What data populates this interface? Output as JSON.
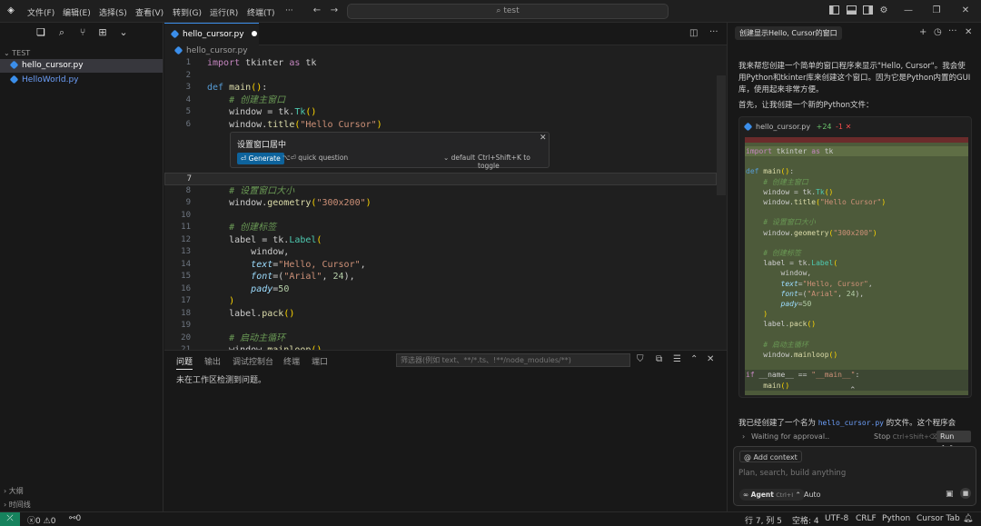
{
  "titlebar": {
    "menus": [
      "文件(F)",
      "编辑(E)",
      "选择(S)",
      "查看(V)",
      "转到(G)",
      "运行(R)",
      "终端(T)",
      "···"
    ],
    "search": "test"
  },
  "explorer": {
    "root": "TEST",
    "files": [
      "hello_cursor.py",
      "HelloWorld.py"
    ],
    "outline_label": "大纲",
    "timeline_label": "时间线"
  },
  "editor": {
    "tab_label": "hello_cursor.py",
    "breadcrumb": "hello_cursor.py",
    "lines": [
      {
        "n": "1",
        "tokens": [
          [
            "kw",
            "import"
          ],
          [
            "",
            " tkinter "
          ],
          [
            "kw",
            "as"
          ],
          [
            "",
            " tk"
          ]
        ]
      },
      {
        "n": "2",
        "tokens": []
      },
      {
        "n": "3",
        "tokens": [
          [
            "kwb",
            "def"
          ],
          [
            "",
            " "
          ],
          [
            "fn",
            "main"
          ],
          [
            "yel",
            "()"
          ],
          [
            "",
            ":"
          ]
        ]
      },
      {
        "n": "4",
        "tokens": [
          [
            "",
            "    "
          ],
          [
            "cm",
            "# 创建主窗口"
          ]
        ]
      },
      {
        "n": "5",
        "tokens": [
          [
            "",
            "    window = tk."
          ],
          [
            "cls",
            "Tk"
          ],
          [
            "yel",
            "()"
          ]
        ]
      },
      {
        "n": "6",
        "tokens": [
          [
            "",
            "    window."
          ],
          [
            "fn",
            "title"
          ],
          [
            "yel",
            "("
          ],
          [
            "str",
            "\"Hello Cursor\""
          ],
          [
            "yel",
            ")"
          ]
        ]
      },
      {
        "n": "7",
        "tokens": []
      },
      {
        "n": "8",
        "tokens": [
          [
            "",
            "    "
          ],
          [
            "cm",
            "# 设置窗口大小"
          ]
        ]
      },
      {
        "n": "9",
        "tokens": [
          [
            "",
            "    window."
          ],
          [
            "fn",
            "geometry"
          ],
          [
            "yel",
            "("
          ],
          [
            "str",
            "\"300x200\""
          ],
          [
            "yel",
            ")"
          ]
        ]
      },
      {
        "n": "10",
        "tokens": []
      },
      {
        "n": "11",
        "tokens": [
          [
            "",
            "    "
          ],
          [
            "cm",
            "# 创建标签"
          ]
        ]
      },
      {
        "n": "12",
        "tokens": [
          [
            "",
            "    label = tk."
          ],
          [
            "cls",
            "Label"
          ],
          [
            "yel",
            "("
          ]
        ]
      },
      {
        "n": "13",
        "tokens": [
          [
            "",
            "        window,"
          ]
        ]
      },
      {
        "n": "14",
        "tokens": [
          [
            "",
            "        "
          ],
          [
            "prm",
            "text"
          ],
          [
            "",
            "="
          ],
          [
            "str",
            "\"Hello, Cursor\""
          ],
          [
            "",
            ","
          ]
        ]
      },
      {
        "n": "15",
        "tokens": [
          [
            "",
            "        "
          ],
          [
            "prm",
            "font"
          ],
          [
            "",
            "=("
          ],
          [
            "str",
            "\"Arial\""
          ],
          [
            "",
            ", "
          ],
          [
            "num",
            "24"
          ],
          [
            "",
            "),"
          ]
        ]
      },
      {
        "n": "16",
        "tokens": [
          [
            "",
            "        "
          ],
          [
            "prm",
            "pady"
          ],
          [
            "",
            "="
          ],
          [
            "num",
            "50"
          ]
        ]
      },
      {
        "n": "17",
        "tokens": [
          [
            "",
            "    "
          ],
          [
            "yel",
            ")"
          ]
        ]
      },
      {
        "n": "18",
        "tokens": [
          [
            "",
            "    label."
          ],
          [
            "fn",
            "pack"
          ],
          [
            "yel",
            "()"
          ]
        ]
      },
      {
        "n": "19",
        "tokens": []
      },
      {
        "n": "20",
        "tokens": [
          [
            "",
            "    "
          ],
          [
            "cm",
            "# 启动主循环"
          ]
        ]
      },
      {
        "n": "21",
        "tokens": [
          [
            "",
            "    window."
          ],
          [
            "fn",
            "mainloop"
          ],
          [
            "yel",
            "()"
          ]
        ]
      }
    ],
    "inline_prompt": {
      "title": "设置窗口居中",
      "generate": "Generate",
      "quick": "quick question",
      "model": "default",
      "hint": "Ctrl+Shift+K to toggle"
    }
  },
  "panel": {
    "tabs": [
      "问题",
      "输出",
      "调试控制台",
      "终端",
      "端口"
    ],
    "filter_placeholder": "筛选器(例如 text、**/*.ts、!**/node_modules/**)",
    "message": "未在工作区检测到问题。"
  },
  "chat": {
    "title": "创建显示Hello, Cursor的窗口",
    "intro": "我来帮您创建一个简单的窗口程序来显示\"Hello, Cursor\"。我会使用Python和tkinter库来创建这个窗口。因为它是Python内置的GUI库，使用起来非常方便。",
    "step": "首先，让我创建一个新的Python文件：",
    "diff_file": "hello_cursor.py",
    "diff_add": "+24",
    "diff_del": "-1",
    "diff_lines": [
      [
        [
          "kw",
          "import"
        ],
        [
          "",
          " tkinter "
        ],
        [
          "kw",
          "as"
        ],
        [
          "",
          " tk"
        ]
      ],
      [],
      [
        [
          "kwb",
          "def"
        ],
        [
          "",
          " "
        ],
        [
          "fn",
          "main"
        ],
        [
          "yel",
          "()"
        ],
        [
          "",
          ":"
        ]
      ],
      [
        [
          "",
          "    "
        ],
        [
          "cm",
          "# 创建主窗口"
        ]
      ],
      [
        [
          "",
          "    window = tk."
        ],
        [
          "cls",
          "Tk"
        ],
        [
          "yel",
          "()"
        ]
      ],
      [
        [
          "",
          "    window."
        ],
        [
          "fn",
          "title"
        ],
        [
          "yel",
          "("
        ],
        [
          "str",
          "\"Hello Cursor\""
        ],
        [
          "yel",
          ")"
        ]
      ],
      [],
      [
        [
          "",
          "    "
        ],
        [
          "cm",
          "# 设置窗口大小"
        ]
      ],
      [
        [
          "",
          "    window."
        ],
        [
          "fn",
          "geometry"
        ],
        [
          "yel",
          "("
        ],
        [
          "str",
          "\"300x200\""
        ],
        [
          "yel",
          ")"
        ]
      ],
      [],
      [
        [
          "",
          "    "
        ],
        [
          "cm",
          "# 创建标签"
        ]
      ],
      [
        [
          "",
          "    label = tk."
        ],
        [
          "cls",
          "Label"
        ],
        [
          "yel",
          "("
        ]
      ],
      [
        [
          "",
          "        window,"
        ]
      ],
      [
        [
          "",
          "        "
        ],
        [
          "prm",
          "text"
        ],
        [
          "",
          "="
        ],
        [
          "str",
          "\"Hello, Cursor\""
        ],
        [
          "",
          ","
        ]
      ],
      [
        [
          "",
          "        "
        ],
        [
          "prm",
          "font"
        ],
        [
          "",
          "=("
        ],
        [
          "str",
          "\"Arial\""
        ],
        [
          "",
          ", "
        ],
        [
          "num",
          "24"
        ],
        [
          "",
          "),"
        ]
      ],
      [
        [
          "",
          "        "
        ],
        [
          "prm",
          "pady"
        ],
        [
          "",
          "="
        ],
        [
          "num",
          "50"
        ]
      ],
      [
        [
          "",
          "    "
        ],
        [
          "yel",
          ")"
        ]
      ],
      [
        [
          "",
          "    label."
        ],
        [
          "fn",
          "pack"
        ],
        [
          "yel",
          "()"
        ]
      ],
      [],
      [
        [
          "",
          "    "
        ],
        [
          "cm",
          "# 启动主循环"
        ]
      ],
      [
        [
          "",
          "    window."
        ],
        [
          "fn",
          "mainloop"
        ],
        [
          "yel",
          "()"
        ]
      ],
      [],
      [
        [
          "kw",
          "if"
        ],
        [
          "",
          " __name__ == "
        ],
        [
          "str",
          "\"__main__\""
        ],
        [
          "",
          ":"
        ]
      ],
      [
        [
          "",
          "    "
        ],
        [
          "fn",
          "main"
        ],
        [
          "yel",
          "()"
        ]
      ]
    ],
    "created_prefix": "我已经创建了一个名为",
    "created_file": "hello_cursor.py",
    "created_suffix": "的文件。这个程序会",
    "waiting": "Waiting for approval..",
    "stop_label": "Stop",
    "stop_hint": "Ctrl+Shift+⌫",
    "run_label": "Run ^⏎",
    "add_context": "Add context",
    "input_placeholder": "Plan, search, build anything",
    "agent_label": "Agent",
    "agent_shortcut": "Ctrl+I",
    "auto_label": "Auto"
  },
  "statusbar": {
    "errors": "0",
    "warnings": "0",
    "ports": "0",
    "position": "行 7, 列 5",
    "spaces": "空格: 4",
    "encoding": "UTF-8",
    "eol": "CRLF",
    "language": "Python",
    "cursor_tab": "Cursor Tab"
  },
  "colors": {
    "accent": "#3b8eea",
    "diff_added_bg": "#4d5a3a",
    "diff_removed_bg": "#6b2b2b",
    "remote": "#16825d"
  }
}
